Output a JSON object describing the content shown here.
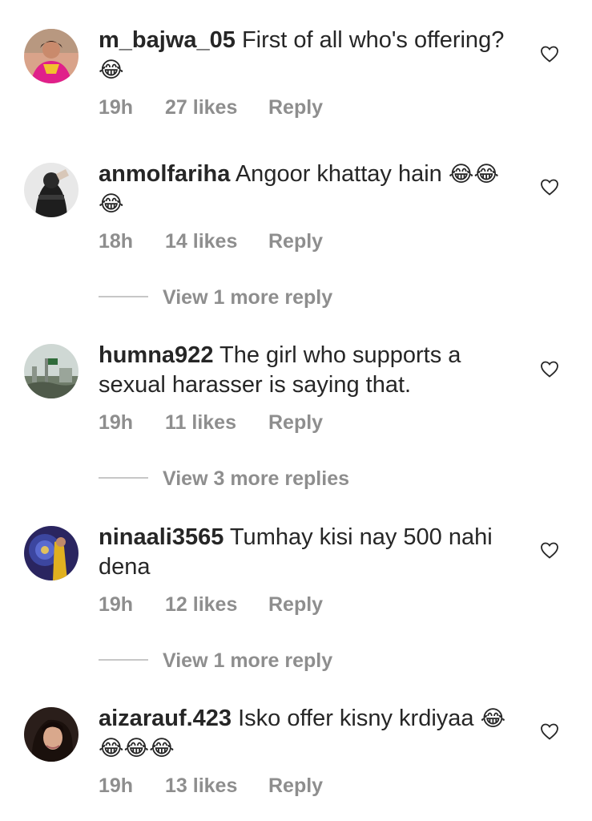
{
  "comments": [
    {
      "username": "m_bajwa_05",
      "text": "First of all who's offering?",
      "emoji": "😂",
      "time": "19h",
      "likes": "27 likes",
      "reply": "Reply",
      "view_more": null
    },
    {
      "username": "anmolfariha",
      "text": "Angoor khattay hain",
      "emoji": "😂😂😂",
      "time": "18h",
      "likes": "14 likes",
      "reply": "Reply",
      "view_more": "View 1 more reply"
    },
    {
      "username": "humna922",
      "text": "The girl who supports a sexual harasser is saying that.",
      "emoji": "",
      "time": "19h",
      "likes": "11 likes",
      "reply": "Reply",
      "view_more": "View 3 more replies"
    },
    {
      "username": "ninaali3565",
      "text": "Tumhay kisi nay 500 nahi dena",
      "emoji": "",
      "time": "19h",
      "likes": "12 likes",
      "reply": "Reply",
      "view_more": "View 1 more reply"
    },
    {
      "username": "aizarauf.423",
      "text": "Isko offer kisny krdiyaa",
      "emoji": "😂😂😂😂",
      "time": "19h",
      "likes": "13 likes",
      "reply": "Reply",
      "view_more": null
    }
  ],
  "icons": {
    "like": "heart-outline-icon",
    "avatar": "user-avatar"
  },
  "colors": {
    "text": "#262626",
    "meta": "#8e8e8e",
    "divider": "#c7c7c7"
  }
}
